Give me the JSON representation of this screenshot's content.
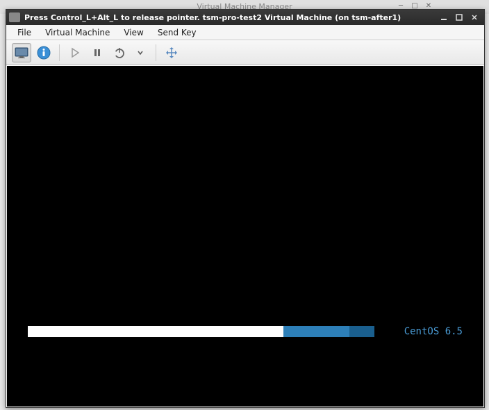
{
  "background_window": {
    "title": "Virtual Machine Manager"
  },
  "window": {
    "title": "Press Control_L+Alt_L to release pointer. tsm-pro-test2 Virtual Machine (on tsm-after1)"
  },
  "menubar": {
    "file": "File",
    "virtual_machine": "Virtual Machine",
    "view": "View",
    "send_key": "Send Key"
  },
  "toolbar": {
    "console_icon": "console",
    "info_icon": "info",
    "play_icon": "play",
    "pause_icon": "pause",
    "power_icon": "power",
    "fullscreen_icon": "fullscreen"
  },
  "vm": {
    "os_label": "CentOS 6.5",
    "progress_white_pct": 70,
    "progress_blue1_pct": 18,
    "progress_blue2_pct": 7
  }
}
